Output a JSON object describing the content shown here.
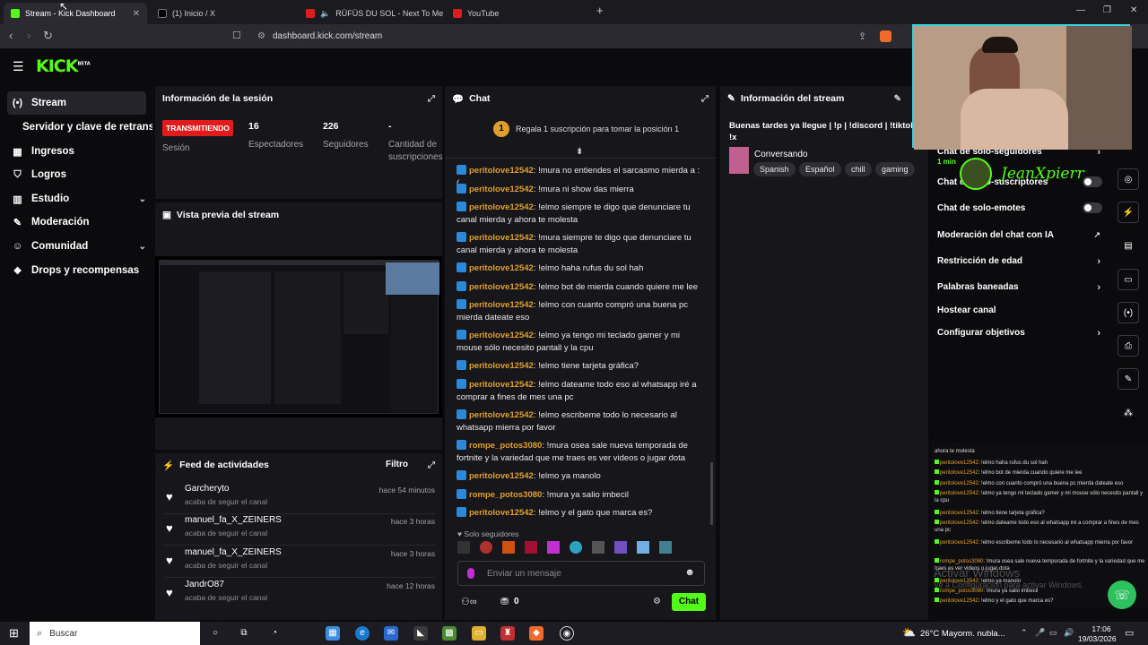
{
  "browser": {
    "tabs": [
      {
        "title": "Stream - Kick Dashboard",
        "active": true
      },
      {
        "title": "(1) Inicio / X",
        "active": false
      },
      {
        "title": "RÜFÜS DU SOL - Next To Me (Offi",
        "active": false
      },
      {
        "title": "YouTube",
        "active": false
      }
    ],
    "url": "dashboard.kick.com/stream"
  },
  "kick": {
    "logo": "KICK",
    "beta": "BETA"
  },
  "sidebar": {
    "items": [
      {
        "label": "Stream",
        "icon": "(•)"
      },
      {
        "label": "Servidor y clave de retransmisión",
        "icon": ""
      },
      {
        "label": "Ingresos",
        "icon": "▦"
      },
      {
        "label": "Logros",
        "icon": "⛉"
      },
      {
        "label": "Estudio",
        "icon": "▥"
      },
      {
        "label": "Moderación",
        "icon": "✎"
      },
      {
        "label": "Comunidad",
        "icon": "☺"
      },
      {
        "label": "Drops y recompensas",
        "icon": "❖"
      }
    ]
  },
  "session": {
    "title": "Información de la sesión",
    "status": "TRANSMITIENDO",
    "session_label": "Sesión",
    "viewers_value": "16",
    "viewers_label": "Espectadores",
    "followers_value": "226",
    "followers_label": "Seguidores",
    "subs_value": "-",
    "subs_label": "Cantidad de suscripciones"
  },
  "preview": {
    "title": "Vista previa del stream"
  },
  "feed": {
    "title": "Feed de actividades",
    "filter": "Filtro",
    "items": [
      {
        "name": "Garcheryto",
        "action": "acaba de seguir el canal",
        "time": "hace 54 minutos"
      },
      {
        "name": "manuel_fa_X_ZEINERS",
        "action": "acaba de seguir el canal",
        "time": "hace 3 horas"
      },
      {
        "name": "manuel_fa_X_ZEINERS",
        "action": "acaba de seguir el canal",
        "time": "hace 3 horas"
      },
      {
        "name": "JandrO87",
        "action": "acaba de seguir el canal",
        "time": "hace 12 horas"
      }
    ]
  },
  "chat": {
    "title": "Chat",
    "pinned_rank": "1",
    "pinned": "Regala 1 suscripción para tomar la posición 1",
    "messages": [
      {
        "user": "peritolove12542",
        "text": ": !mura no entiendes el sarcasmo mierda a :("
      },
      {
        "user": "peritolove12542",
        "text": ": !mura ni show das mierra"
      },
      {
        "user": "peritolove12542",
        "text": ": !elmo siempre te digo que denunciare tu canal mierda y ahora te molesta"
      },
      {
        "user": "peritolove12542",
        "text": ": !mura siempre te digo que denunciare tu canal mierda y ahora te molesta"
      },
      {
        "user": "peritolove12542",
        "text": ": !elmo haha rufus du sol hah"
      },
      {
        "user": "peritolove12542",
        "text": ": !elmo bot de mierda cuando quiere me lee"
      },
      {
        "user": "peritolove12542",
        "text": ": !elmo con cuanto compró una buena pc mierda dateate eso"
      },
      {
        "user": "peritolove12542",
        "text": ": !elmo ya tengo mi teclado gamer y mi mouse sólo necesito pantall y la cpu"
      },
      {
        "user": "peritolove12542",
        "text": ": !elmo tiene tarjeta gráfica?"
      },
      {
        "user": "peritolove12542",
        "text": ": !elmo dateame todo eso al whatsapp iré a comprar a fines de mes una pc"
      },
      {
        "user": "peritolove12542",
        "text": ": !elmo escribeme todo lo necesario al whatsapp mierra por favor"
      },
      {
        "user": "rompe_potos3080",
        "text": ": !mura osea sale nueva temporada de fortnite y la variedad que me traes es ver videos o jugar dota"
      },
      {
        "user": "peritolove12542",
        "text": ": !elmo ya manolo"
      },
      {
        "user": "rompe_potos3080",
        "text": ": !mura ya salio imbecil"
      },
      {
        "user": "peritolove12542",
        "text": ": !elmo y el gato que marca es?"
      }
    ],
    "followers_only": "Solo seguidores",
    "input_placeholder": "Enviar un mensaje",
    "points": "0",
    "send": "Chat"
  },
  "stream_info": {
    "title": "Información del stream",
    "stream_title": "Buenas tardes ya llegue | !p | !discord | !tiktok !x",
    "category": "Conversando",
    "tags": [
      "Spanish",
      "Español",
      "chill",
      "gaming"
    ]
  },
  "settings": {
    "rows": [
      {
        "label": "Chat de solo-seguidores",
        "sub": "1 min"
      },
      {
        "label": "Chat de solo-suscriptores"
      },
      {
        "label": "Chat de solo-emotes"
      },
      {
        "label": "Moderación del chat con IA"
      },
      {
        "label": "Restricción de edad"
      },
      {
        "label": "Palabras baneadas"
      },
      {
        "label": "Hostear canal"
      },
      {
        "label": "Configurar objetivos"
      }
    ]
  },
  "overlay": {
    "webcam_name": "JeanXpierr",
    "lines": [
      {
        "user": "",
        "text": "ahora te molesta"
      },
      {
        "user": "peritolove12542",
        "text": ": !elmo haha rufus du sol hah"
      },
      {
        "user": "peritolove12542",
        "text": ": !elmo bot de mierda cuando quiere me lee"
      },
      {
        "user": "peritolove12542",
        "text": ": !elmo con cuanto compró una buena pc mierda dateate eso"
      },
      {
        "user": "peritolove12542",
        "text": ": !elmo ya tengo mi teclado gamer y mi mouse sólo necesito pantall y la cpu"
      },
      {
        "user": "peritolove12542",
        "text": ": !elmo tiene tarjeta gráfica?"
      },
      {
        "user": "peritolove12542",
        "text": ": !elmo dateame todo eso al whatsapp iré a comprar a fines de mes una pc"
      },
      {
        "user": "peritolove12542",
        "text": ": !elmo escribeme todo lo necesario al whatsapp mierra por favor"
      },
      {
        "user": "rompe_potos3080",
        "text": ": !mura osea sale nueva temporada de fortnite y la variedad que me traes es ver videos o jugar dota"
      },
      {
        "user": "peritolove12542",
        "text": ": !elmo ya manolo"
      },
      {
        "user": "rompe_potos3080",
        "text": ": !mura ya salio imbecil"
      },
      {
        "user": "peritolove12542",
        "text": ": !elmo y el gato que marca es?"
      }
    ],
    "watermark1": "Activar Windows",
    "watermark2": "Ve a Configuración para activar Windows."
  },
  "taskbar": {
    "search": "Buscar",
    "weather": "26°C  Mayorm. nubla...",
    "time": "17:06",
    "date": "19/03/2026"
  },
  "colors": {
    "kick_green": "#53fc18",
    "live_red": "#e01b1b",
    "username": "#e0a030",
    "panel": "#17171b"
  }
}
